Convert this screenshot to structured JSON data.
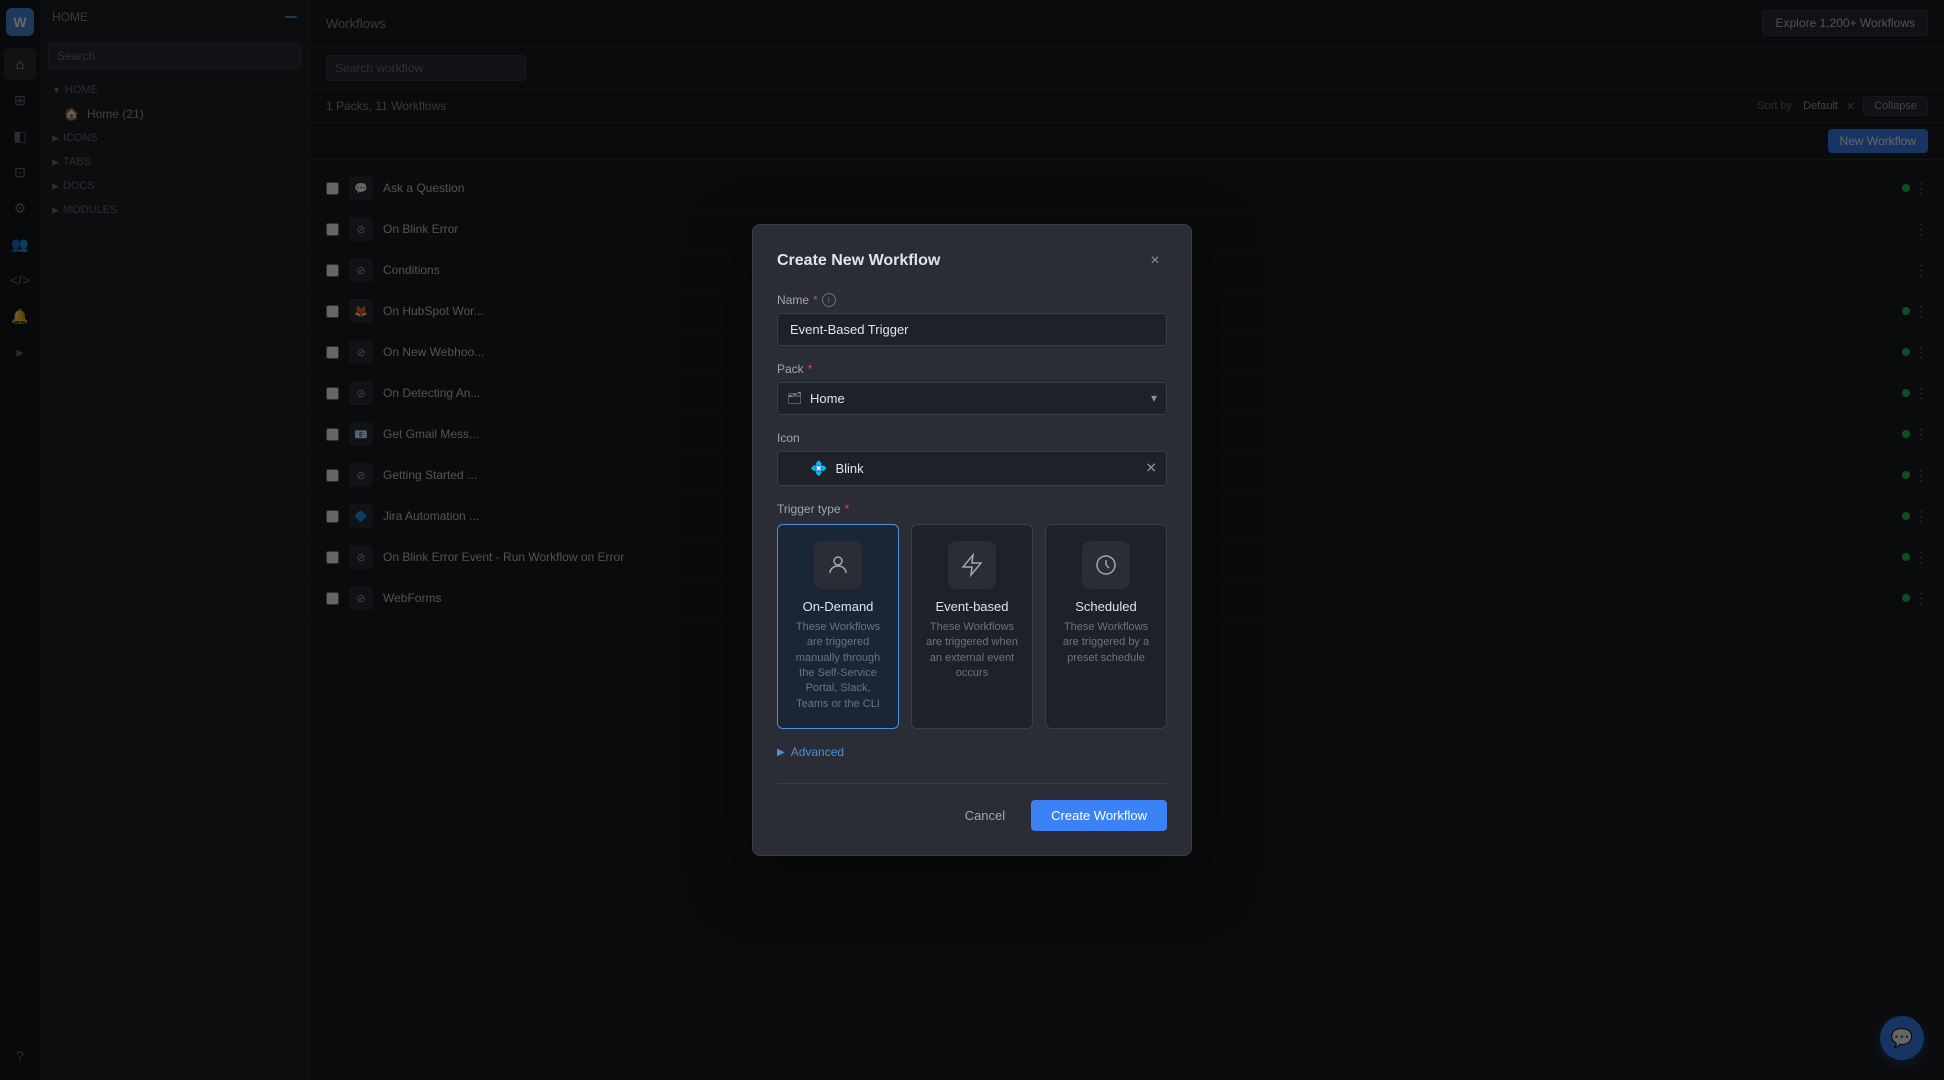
{
  "app": {
    "title": "Workflows"
  },
  "sidebar": {
    "logo_icon": "W",
    "icons": [
      "home",
      "search",
      "grid",
      "layers",
      "settings",
      "users",
      "code",
      "bell",
      "terminal",
      "help"
    ]
  },
  "left_panel": {
    "header_label": "HOME",
    "badge_count": "",
    "search_placeholder": "Search",
    "sections": [
      {
        "label": "HOME",
        "badge": ""
      },
      {
        "label": "ICONS",
        "badge": ""
      },
      {
        "label": "TABS",
        "badge": ""
      },
      {
        "label": "DOCS",
        "badge": ""
      },
      {
        "label": "MODULES",
        "badge": ""
      }
    ],
    "home_item": {
      "label": "Home (21)",
      "icon": "🏠"
    }
  },
  "main": {
    "header_title": "Workflows",
    "search_placeholder": "Search workflow",
    "breadcrumb": "1 Packs, 11 Workflows",
    "sort_label": "Sort by:",
    "sort_value": "Default",
    "new_workflow_btn": "New Workflow",
    "explore_btn": "Explore 1,200+ Workflows",
    "collapse_btn": "Collapse"
  },
  "workflow_items": [
    {
      "name": "Ask a Question",
      "icon": "💬",
      "active": true
    },
    {
      "name": "On Blink Error",
      "icon": "⊘",
      "active": false
    },
    {
      "name": "Conditions",
      "icon": "⊘",
      "active": false
    },
    {
      "name": "On HubSpot Wor...",
      "icon": "🦊",
      "active": true
    },
    {
      "name": "On New Webhoo...",
      "icon": "⊘",
      "active": true
    },
    {
      "name": "On Detecting An...",
      "icon": "⊘",
      "active": true
    },
    {
      "name": "Get Gmail Mess...",
      "icon": "📧",
      "active": true
    },
    {
      "name": "Getting Started ...",
      "icon": "⊘",
      "active": true
    },
    {
      "name": "Jira Automation ...",
      "icon": "🔷",
      "active": true
    },
    {
      "name": "On Blink Error Event - Run Workflow on Error",
      "icon": "⊘",
      "active": true
    },
    {
      "name": "WebForms",
      "icon": "⊘",
      "active": true
    }
  ],
  "modal": {
    "title": "Create New Workflow",
    "close_label": "×",
    "name_label": "Name",
    "name_placeholder": "",
    "name_value": "Event-Based Trigger",
    "pack_label": "Pack",
    "pack_value": "Home",
    "pack_icon": "🏠",
    "icon_label": "Icon",
    "icon_value": "Blink",
    "icon_symbol": "💠",
    "trigger_label": "Trigger type",
    "trigger_types": [
      {
        "id": "on-demand",
        "title": "On-Demand",
        "icon": "👤",
        "description": "These Workflows are triggered manually through the Self-Service Portal, Slack, Teams or the CLI",
        "selected": true
      },
      {
        "id": "event-based",
        "title": "Event-based",
        "icon": "⚡",
        "description": "These Workflows are triggered when an external event occurs",
        "selected": false
      },
      {
        "id": "scheduled",
        "title": "Scheduled",
        "icon": "🕐",
        "description": "These Workflows are triggered by a preset schedule",
        "selected": false
      }
    ],
    "advanced_label": "Advanced",
    "cancel_btn": "Cancel",
    "create_btn": "Create Workflow"
  }
}
